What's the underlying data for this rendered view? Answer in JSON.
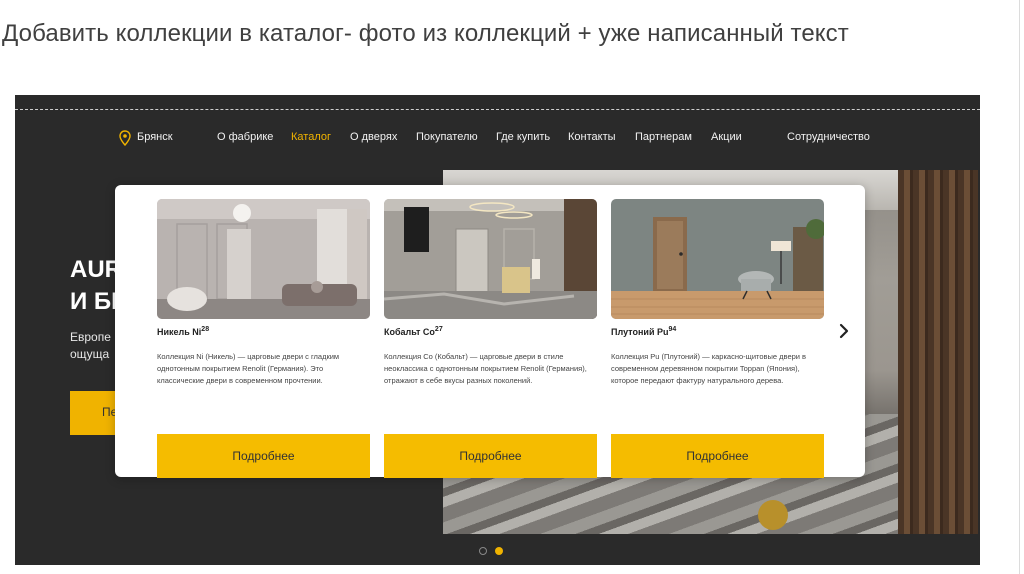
{
  "slide": {
    "title": "Добавить коллекции в каталог- фото из коллекций + уже написанный текст"
  },
  "nav": {
    "city": "Брянск",
    "items": [
      "О фабрике",
      "Каталог",
      "О дверях",
      "Покупателю",
      "Где купить",
      "Контакты",
      "Партнерам",
      "Акции",
      "Сотрудничество"
    ],
    "active": "Каталог",
    "accent_color": "#f0b300"
  },
  "hero": {
    "line1": "AUR",
    "line2": "И БІ",
    "sub1": "Европе",
    "sub2": "ощуща",
    "button_label": "Пе"
  },
  "collections": [
    {
      "name": "Никель Ni",
      "superscript": "28",
      "description": "Коллекция Ni (Никель) — царговые двери с гладким однотонным покрытием Renolit (Германия). Это классические двери в современном прочтении.",
      "button": "Подробнее"
    },
    {
      "name": "Кобальт Co",
      "superscript": "27",
      "description": "Коллекция Co (Кобальт) — царговые двери в стиле неоклассика с однотонным покрытием Renolit (Германия), отражают в себе вкусы разных поколений.",
      "button": "Подробнее"
    },
    {
      "name": "Плутоний Pu",
      "superscript": "94",
      "description": "Коллекция Pu (Плутоний) — каркасно-щитовые двери в современном деревянном покрытии Toppan (Япония), которое передают фактуру натурального дерева.",
      "button": "Подробнее"
    }
  ],
  "carousel": {
    "pages": 2,
    "active_page": 2,
    "button_color": "#f5bc00"
  }
}
